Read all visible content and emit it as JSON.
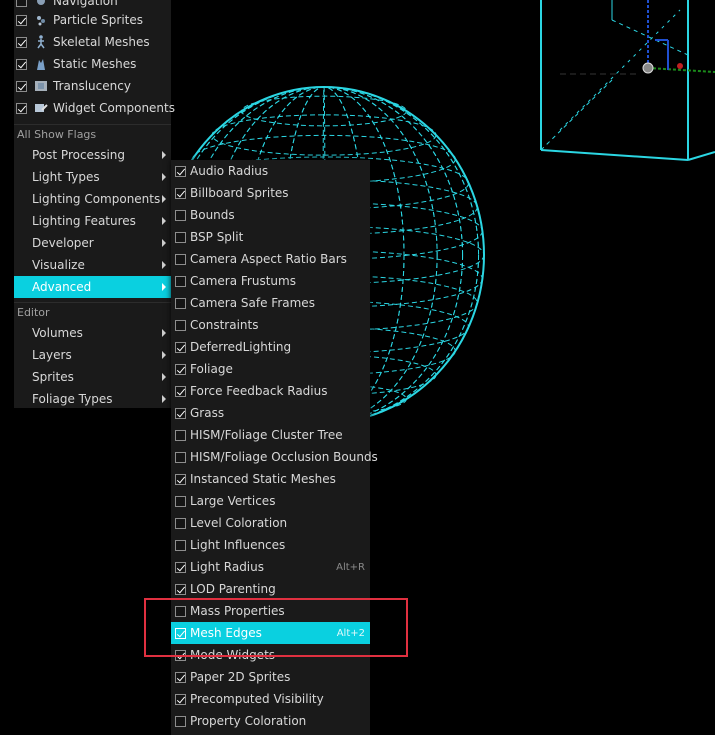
{
  "viewport": {
    "wireframe_color": "#2bd6e3",
    "background_color": "#000000"
  },
  "left_menu": {
    "top_items": [
      {
        "label": "Navigation",
        "checked": false,
        "icon": "navigation-icon"
      },
      {
        "label": "Particle Sprites",
        "checked": true,
        "icon": "particle-sprites-icon"
      },
      {
        "label": "Skeletal Meshes",
        "checked": true,
        "icon": "skeletal-mesh-icon"
      },
      {
        "label": "Static Meshes",
        "checked": true,
        "icon": "static-mesh-icon"
      },
      {
        "label": "Translucency",
        "checked": true,
        "icon": "translucency-icon"
      },
      {
        "label": "Widget Components",
        "checked": true,
        "icon": "widget-components-icon"
      }
    ],
    "all_show_flags_header": "All Show Flags",
    "submenus": [
      {
        "label": "Post Processing"
      },
      {
        "label": "Light Types"
      },
      {
        "label": "Lighting Components"
      },
      {
        "label": "Lighting Features"
      },
      {
        "label": "Developer"
      },
      {
        "label": "Visualize"
      },
      {
        "label": "Advanced",
        "highlighted": true
      }
    ],
    "editor_header": "Editor",
    "editor_submenus": [
      {
        "label": "Volumes"
      },
      {
        "label": "Layers"
      },
      {
        "label": "Sprites"
      },
      {
        "label": "Foliage Types"
      }
    ]
  },
  "advanced_menu": {
    "items": [
      {
        "label": "Audio Radius",
        "checked": true
      },
      {
        "label": "Billboard Sprites",
        "checked": true
      },
      {
        "label": "Bounds",
        "checked": false
      },
      {
        "label": "BSP Split",
        "checked": false
      },
      {
        "label": "Camera Aspect Ratio Bars",
        "checked": false
      },
      {
        "label": "Camera Frustums",
        "checked": false
      },
      {
        "label": "Camera Safe Frames",
        "checked": false
      },
      {
        "label": "Constraints",
        "checked": false
      },
      {
        "label": "DeferredLighting",
        "checked": true
      },
      {
        "label": "Foliage",
        "checked": true
      },
      {
        "label": "Force Feedback Radius",
        "checked": true
      },
      {
        "label": "Grass",
        "checked": true
      },
      {
        "label": "HISM/Foliage Cluster Tree",
        "checked": false
      },
      {
        "label": "HISM/Foliage Occlusion Bounds",
        "checked": false
      },
      {
        "label": "Instanced Static Meshes",
        "checked": true
      },
      {
        "label": "Large Vertices",
        "checked": false
      },
      {
        "label": "Level Coloration",
        "checked": false
      },
      {
        "label": "Light Influences",
        "checked": false
      },
      {
        "label": "Light Radius",
        "checked": true,
        "shortcut": "Alt+R"
      },
      {
        "label": "LOD Parenting",
        "checked": true
      },
      {
        "label": "Mass Properties",
        "checked": false
      },
      {
        "label": "Mesh Edges",
        "checked": true,
        "shortcut": "Alt+2",
        "highlighted": true
      },
      {
        "label": "Mode Widgets",
        "checked": true
      },
      {
        "label": "Paper 2D Sprites",
        "checked": true
      },
      {
        "label": "Precomputed Visibility",
        "checked": true
      },
      {
        "label": "Property Coloration",
        "checked": false
      }
    ]
  },
  "annotation": {
    "highlight_color": "#e03040"
  }
}
